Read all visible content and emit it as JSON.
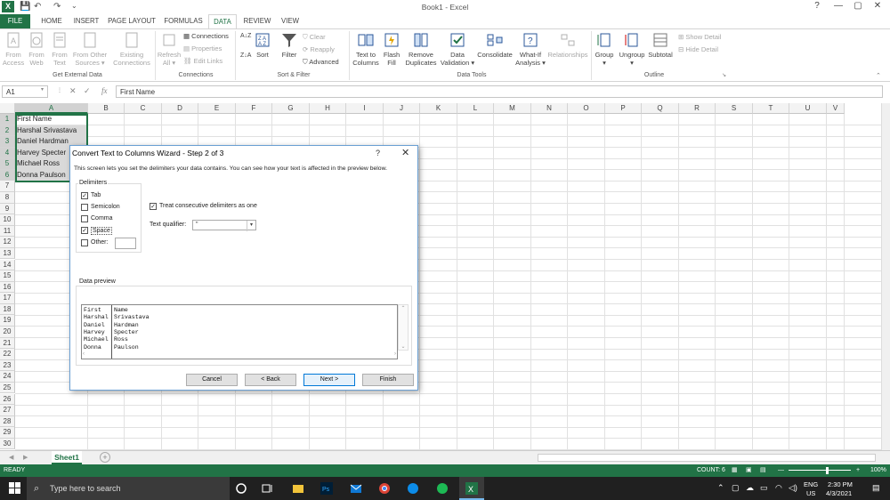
{
  "window": {
    "title": "Book1 - Excel",
    "controls": [
      "?",
      "—",
      "▢",
      "✕"
    ]
  },
  "tabs": [
    {
      "label": "FILE"
    },
    {
      "label": "HOME"
    },
    {
      "label": "INSERT"
    },
    {
      "label": "PAGE LAYOUT"
    },
    {
      "label": "FORMULAS"
    },
    {
      "label": "DATA"
    },
    {
      "label": "REVIEW"
    },
    {
      "label": "VIEW"
    }
  ],
  "active_tab": "DATA",
  "ribbon": {
    "get_external": {
      "buttons": [
        "From Access",
        "From Web",
        "From Text",
        "From Other Sources ▾",
        "Existing Connections"
      ],
      "group": "Get External Data"
    },
    "connections": {
      "refresh": "Refresh All ▾",
      "items": [
        "Connections",
        "Properties",
        "Edit Links"
      ],
      "group": "Connections"
    },
    "sort_filter": {
      "sort": "Sort",
      "filter": "Filter",
      "items": [
        "Clear",
        "Reapply",
        "Advanced"
      ],
      "group": "Sort & Filter"
    },
    "data_tools": {
      "buttons": [
        "Text to Columns",
        "Flash Fill",
        "Remove Duplicates",
        "Data Validation ▾",
        "Consolidate",
        "What-If Analysis ▾",
        "Relationships"
      ],
      "group": "Data Tools"
    },
    "outline": {
      "buttons": [
        "Group ▾",
        "Ungroup ▾",
        "Subtotal"
      ],
      "items": [
        "Show Detail",
        "Hide Detail"
      ],
      "group": "Outline"
    }
  },
  "formula_bar": {
    "name_box": "A1",
    "fx": "fx",
    "content": "First Name"
  },
  "columns": [
    "A",
    "B",
    "C",
    "D",
    "E",
    "F",
    "G",
    "H",
    "I",
    "J",
    "K",
    "L",
    "M",
    "N",
    "O",
    "P",
    "Q",
    "R",
    "S",
    "T",
    "U",
    "V"
  ],
  "rows": [
    "1",
    "2",
    "3",
    "4",
    "5",
    "6",
    "7",
    "8",
    "9",
    "10",
    "11",
    "12",
    "13",
    "14",
    "15",
    "16",
    "17",
    "18",
    "19",
    "20",
    "21",
    "22",
    "23",
    "24",
    "25",
    "26",
    "27",
    "28",
    "29",
    "30"
  ],
  "cells_a": [
    "First Name",
    "Harshal Srivastava",
    "Daniel Hardman",
    "Harvey Specter",
    "Michael Ross",
    "Donna Paulson"
  ],
  "dialog": {
    "title": "Convert Text to Columns Wizard - Step 2 of 3",
    "help": "?",
    "close": "✕",
    "description": "This screen lets you set the delimiters your data contains.  You can see how your text is affected in the preview below.",
    "delimiters_label": "Delimiters",
    "delimiters": [
      {
        "label": "Tab",
        "checked": true
      },
      {
        "label": "Semicolon",
        "checked": false
      },
      {
        "label": "Comma",
        "checked": false
      },
      {
        "label": "Space",
        "checked": true
      },
      {
        "label": "Other:",
        "checked": false
      }
    ],
    "consecutive_label": "Treat consecutive delimiters as one",
    "consecutive_checked": true,
    "qualifier_label": "Text qualifier:",
    "qualifier_value": "\"",
    "preview_label": "Data preview",
    "preview_rows": [
      [
        "First",
        "Name"
      ],
      [
        "Harshal",
        "Srivastava"
      ],
      [
        "Daniel",
        "Hardman"
      ],
      [
        "Harvey",
        "Specter"
      ],
      [
        "Michael",
        "Ross"
      ],
      [
        "Donna",
        "Paulson"
      ]
    ],
    "buttons": {
      "cancel": "Cancel",
      "back": "< Back",
      "next": "Next >",
      "finish": "Finish"
    }
  },
  "sheet_tab": "Sheet1",
  "status": {
    "ready": "READY",
    "count": "COUNT: 6",
    "zoom": "100%"
  },
  "taskbar": {
    "search_placeholder": "Type here to search",
    "lang": "ENG",
    "region": "US",
    "time": "2:30 PM",
    "date": "4/3/2021"
  },
  "colors": {
    "excel_green": "#217346",
    "taskbar": "#202020"
  }
}
